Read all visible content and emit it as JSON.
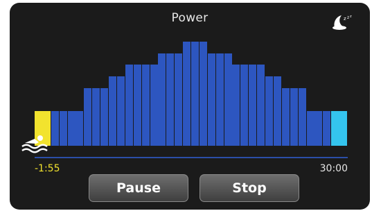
{
  "header": {
    "title": "Power",
    "sleep_icon": "sleep-icon"
  },
  "chart_data": {
    "type": "bar",
    "levels": [
      3,
      3,
      3,
      3,
      3,
      3,
      5,
      5,
      5,
      6,
      6,
      7,
      7,
      7,
      7,
      8,
      8,
      8,
      9,
      9,
      9,
      8,
      8,
      8,
      7,
      7,
      7,
      7,
      6,
      6,
      5,
      5,
      5,
      3,
      3,
      3,
      3,
      3
    ],
    "current_index": 0,
    "last_index": 37,
    "ylim": [
      0,
      9
    ]
  },
  "timeline": {
    "elapsed": "-1:55",
    "total": "30:00",
    "activity_icon": "swimmer-icon"
  },
  "controls": {
    "pause_label": "Pause",
    "stop_label": "Stop"
  },
  "colors": {
    "bar": "#2d56c0",
    "current": "#f2e32e",
    "last": "#34c4ee",
    "timeline": "#2b4ea8",
    "elapsed_text": "#f2e32e"
  }
}
